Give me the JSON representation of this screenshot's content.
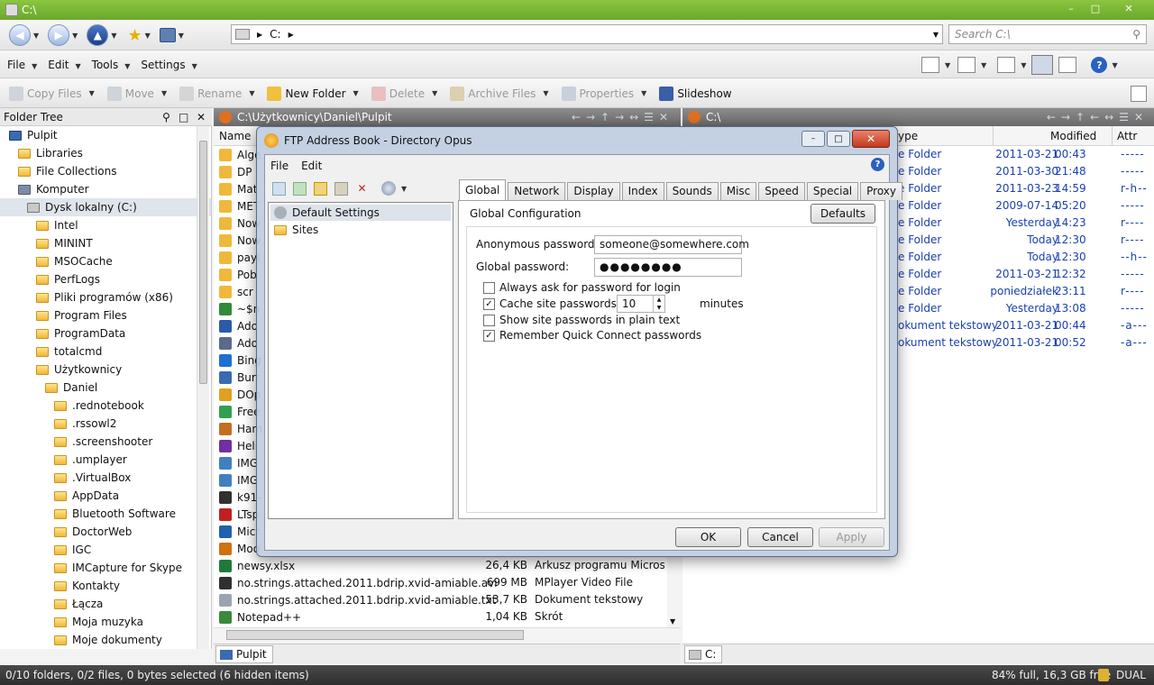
{
  "window": {
    "title": "C:\\"
  },
  "nav": {
    "address_drive": "C:",
    "search_placeholder": "Search C:\\"
  },
  "menu": [
    "File",
    "Edit",
    "Tools",
    "Settings"
  ],
  "toolbar": {
    "copy": "Copy Files",
    "move": "Move",
    "rename": "Rename",
    "new_folder": "New Folder",
    "delete": "Delete",
    "archive": "Archive Files",
    "properties": "Properties",
    "slideshow": "Slideshow"
  },
  "tree": {
    "header": "Folder Tree",
    "items": [
      {
        "label": "Pulpit",
        "indent": 0,
        "icon": "desktop-icon"
      },
      {
        "label": "Libraries",
        "indent": 1,
        "icon": "folder-icon"
      },
      {
        "label": "File Collections",
        "indent": 1,
        "icon": "folder-icon"
      },
      {
        "label": "Komputer",
        "indent": 1,
        "icon": "computer-icon"
      },
      {
        "label": "Dysk lokalny (C:)",
        "indent": 2,
        "icon": "drive-icon",
        "selected": true
      },
      {
        "label": "Intel",
        "indent": 3,
        "icon": "folder-icon"
      },
      {
        "label": "MININT",
        "indent": 3,
        "icon": "folder-icon"
      },
      {
        "label": "MSOCache",
        "indent": 3,
        "icon": "folder-icon"
      },
      {
        "label": "PerfLogs",
        "indent": 3,
        "icon": "folder-icon"
      },
      {
        "label": "Pliki programów (x86)",
        "indent": 3,
        "icon": "folder-icon"
      },
      {
        "label": "Program Files",
        "indent": 3,
        "icon": "folder-icon"
      },
      {
        "label": "ProgramData",
        "indent": 3,
        "icon": "folder-icon"
      },
      {
        "label": "totalcmd",
        "indent": 3,
        "icon": "folder-icon"
      },
      {
        "label": "Użytkownicy",
        "indent": 3,
        "icon": "folder-icon"
      },
      {
        "label": "Daniel",
        "indent": 4,
        "icon": "folder-icon"
      },
      {
        "label": ".rednotebook",
        "indent": 5,
        "icon": "folder-icon"
      },
      {
        "label": ".rssowl2",
        "indent": 5,
        "icon": "folder-icon"
      },
      {
        "label": ".screenshooter",
        "indent": 5,
        "icon": "folder-icon"
      },
      {
        "label": ".umplayer",
        "indent": 5,
        "icon": "folder-icon"
      },
      {
        "label": ".VirtualBox",
        "indent": 5,
        "icon": "folder-icon"
      },
      {
        "label": "AppData",
        "indent": 5,
        "icon": "folder-icon"
      },
      {
        "label": "Bluetooth Software",
        "indent": 5,
        "icon": "folder-icon"
      },
      {
        "label": "DoctorWeb",
        "indent": 5,
        "icon": "folder-icon"
      },
      {
        "label": "IGC",
        "indent": 5,
        "icon": "folder-icon"
      },
      {
        "label": "IMCapture for Skype",
        "indent": 5,
        "icon": "folder-icon"
      },
      {
        "label": "Kontakty",
        "indent": 5,
        "icon": "folder-icon"
      },
      {
        "label": "Łącza",
        "indent": 5,
        "icon": "folder-icon"
      },
      {
        "label": "Moja muzyka",
        "indent": 5,
        "icon": "folder-icon"
      },
      {
        "label": "Moje dokumenty",
        "indent": 5,
        "icon": "folder-icon"
      }
    ]
  },
  "left_pane": {
    "path": "C:\\Użytkownicy\\Daniel\\Pulpit",
    "col_name": "Name",
    "rows": [
      {
        "name": "Alge",
        "size": "",
        "type": "",
        "color": "#f0b83a"
      },
      {
        "name": "DP",
        "size": "",
        "type": "",
        "color": "#f0b83a"
      },
      {
        "name": "Mat",
        "size": "",
        "type": "",
        "color": "#f0b83a"
      },
      {
        "name": "MET",
        "size": "",
        "type": "",
        "color": "#f0b83a"
      },
      {
        "name": "Now",
        "size": "",
        "type": "",
        "color": "#f0b83a"
      },
      {
        "name": "Now",
        "size": "",
        "type": "",
        "color": "#f0b83a"
      },
      {
        "name": "payl",
        "size": "",
        "type": "",
        "color": "#f0b83a"
      },
      {
        "name": "Pob",
        "size": "",
        "type": "",
        "color": "#f0b83a"
      },
      {
        "name": "scr",
        "size": "",
        "type": "",
        "color": "#f0b83a"
      },
      {
        "name": "~$n",
        "size": "",
        "type": "",
        "color": "#2f8a3a"
      },
      {
        "name": "Ado",
        "size": "",
        "type": "",
        "color": "#2a5aa8"
      },
      {
        "name": "Ado",
        "size": "",
        "type": "",
        "color": "#5a6a8a"
      },
      {
        "name": "Bing",
        "size": "",
        "type": "",
        "color": "#1e6fd0"
      },
      {
        "name": "Burr",
        "size": "",
        "type": "",
        "color": "#3a6ab0"
      },
      {
        "name": "DOp",
        "size": "",
        "type": "",
        "color": "#e0a020"
      },
      {
        "name": "Free",
        "size": "",
        "type": "",
        "color": "#30a050"
      },
      {
        "name": "Ham",
        "size": "",
        "type": "",
        "color": "#c07020"
      },
      {
        "name": "Heli",
        "size": "",
        "type": "",
        "color": "#7030a0"
      },
      {
        "name": "IMG",
        "size": "",
        "type": "",
        "color": "#4080c0"
      },
      {
        "name": "IMG",
        "size": "",
        "type": "",
        "color": "#4080c0"
      },
      {
        "name": "k91-",
        "size": "",
        "type": "",
        "color": "#303030"
      },
      {
        "name": "LTsp",
        "size": "",
        "type": "",
        "color": "#c02020"
      },
      {
        "name": "Micr",
        "size": "",
        "type": "",
        "color": "#2060b0"
      },
      {
        "name": "Moo",
        "size": "",
        "type": "",
        "color": "#d07010"
      },
      {
        "name": "newsy.xlsx",
        "size": "26,4 KB",
        "type": "Arkusz programu Microsoft",
        "color": "#1f7a3a"
      },
      {
        "name": "no.strings.attached.2011.bdrip.xvid-amiable.avi",
        "size": "699 MB",
        "type": "MPlayer Video File",
        "color": "#303030"
      },
      {
        "name": "no.strings.attached.2011.bdrip.xvid-amiable.txt",
        "size": "53,7 KB",
        "type": "Dokument tekstowy",
        "color": "#9aa4b0"
      },
      {
        "name": "Notepad++",
        "size": "1,04 KB",
        "type": "Skrót",
        "color": "#3a8a3a"
      }
    ],
    "tab": "Pulpit"
  },
  "right_pane": {
    "path": "C:\\",
    "col_type": "ype",
    "col_modified": "Modified",
    "col_attr": "Attr",
    "rows": [
      {
        "type": "e Folder",
        "date": "2011-03-21",
        "time": "00:43",
        "attr": "-----"
      },
      {
        "type": "e Folder",
        "date": "2011-03-30",
        "time": "21:48",
        "attr": "-----"
      },
      {
        "type": "e Folder",
        "date": "2011-03-23",
        "time": "14:59",
        "attr": "r-h--"
      },
      {
        "type": "e Folder",
        "date": "2009-07-14",
        "time": "05:20",
        "attr": "-----"
      },
      {
        "type": "e Folder",
        "date": "Yesterday",
        "time": "14:23",
        "attr": "r----"
      },
      {
        "type": "e Folder",
        "date": "Today",
        "time": "12:30",
        "attr": "r----"
      },
      {
        "type": "e Folder",
        "date": "Today",
        "time": "12:30",
        "attr": "--h--"
      },
      {
        "type": "e Folder",
        "date": "2011-03-21",
        "time": "12:32",
        "attr": "-----"
      },
      {
        "type": "e Folder",
        "date": "poniedziałek",
        "time": "23:11",
        "attr": "r----"
      },
      {
        "type": "e Folder",
        "date": "Yesterday",
        "time": "13:08",
        "attr": "-----"
      },
      {
        "type": "okument tekstowy",
        "date": "2011-03-21",
        "time": "00:44",
        "attr": "-a---"
      },
      {
        "type": "okument tekstowy",
        "date": "2011-03-21",
        "time": "00:52",
        "attr": "-a---"
      }
    ],
    "tab": "C:"
  },
  "status": {
    "left": "0/10 folders, 0/2 files, 0 bytes selected (6 hidden items)",
    "right": "84% full, 16,3 GB free",
    "mode": "DUAL"
  },
  "dialog": {
    "title": "FTP Address Book - Directory Opus",
    "menu": [
      "File",
      "Edit"
    ],
    "tree": [
      "Default Settings",
      "Sites"
    ],
    "tabs": [
      "Global",
      "Network",
      "Display",
      "Index",
      "Sounds",
      "Misc",
      "Speed",
      "Special",
      "Proxy"
    ],
    "section": "Global Configuration",
    "defaults_btn": "Defaults",
    "anon_label": "Anonymous password:",
    "anon_value": "someone@somewhere.com",
    "global_label": "Global password:",
    "global_value": "●●●●●●●●",
    "chk_always": "Always ask for password for login",
    "chk_cache": "Cache site passwords for",
    "cache_minutes": "10",
    "minutes_label": "minutes",
    "chk_show": "Show site passwords in plain text",
    "chk_remember": "Remember Quick Connect passwords",
    "ok": "OK",
    "cancel": "Cancel",
    "apply": "Apply"
  },
  "colors": {
    "accent": "#7ab834",
    "link_blue": "#1a3fb0"
  }
}
